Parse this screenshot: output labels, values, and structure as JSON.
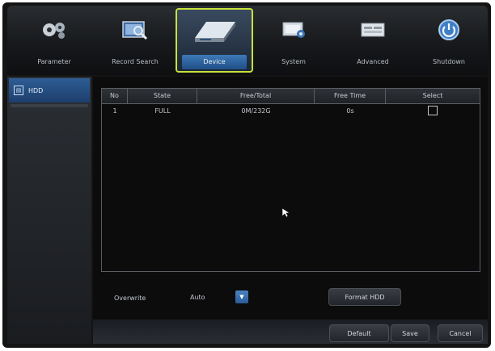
{
  "toolbar": {
    "items": [
      {
        "label": "Parameter",
        "icon": "gears-icon"
      },
      {
        "label": "Record Search",
        "icon": "record-search-icon"
      },
      {
        "label": "Device",
        "icon": "hdd-device-icon",
        "active": true
      },
      {
        "label": "System",
        "icon": "system-monitor-icon"
      },
      {
        "label": "Advanced",
        "icon": "advanced-icon"
      },
      {
        "label": "Shutdown",
        "icon": "power-icon"
      }
    ],
    "active_color": "#c6e23a"
  },
  "sidebar": {
    "items": [
      {
        "label": "HDD",
        "selected": true
      }
    ]
  },
  "table": {
    "headers": [
      "No",
      "State",
      "Free/Total",
      "Free Time",
      "Select"
    ],
    "rows": [
      {
        "no": "1",
        "state": "FULL",
        "free_total": "0M/232G",
        "free_time": "0s",
        "selected": false
      }
    ]
  },
  "overwrite": {
    "label": "Overwrite",
    "value": "Auto"
  },
  "buttons": {
    "format": "Format HDD",
    "default": "Default",
    "save": "Save",
    "cancel": "Cancel"
  }
}
